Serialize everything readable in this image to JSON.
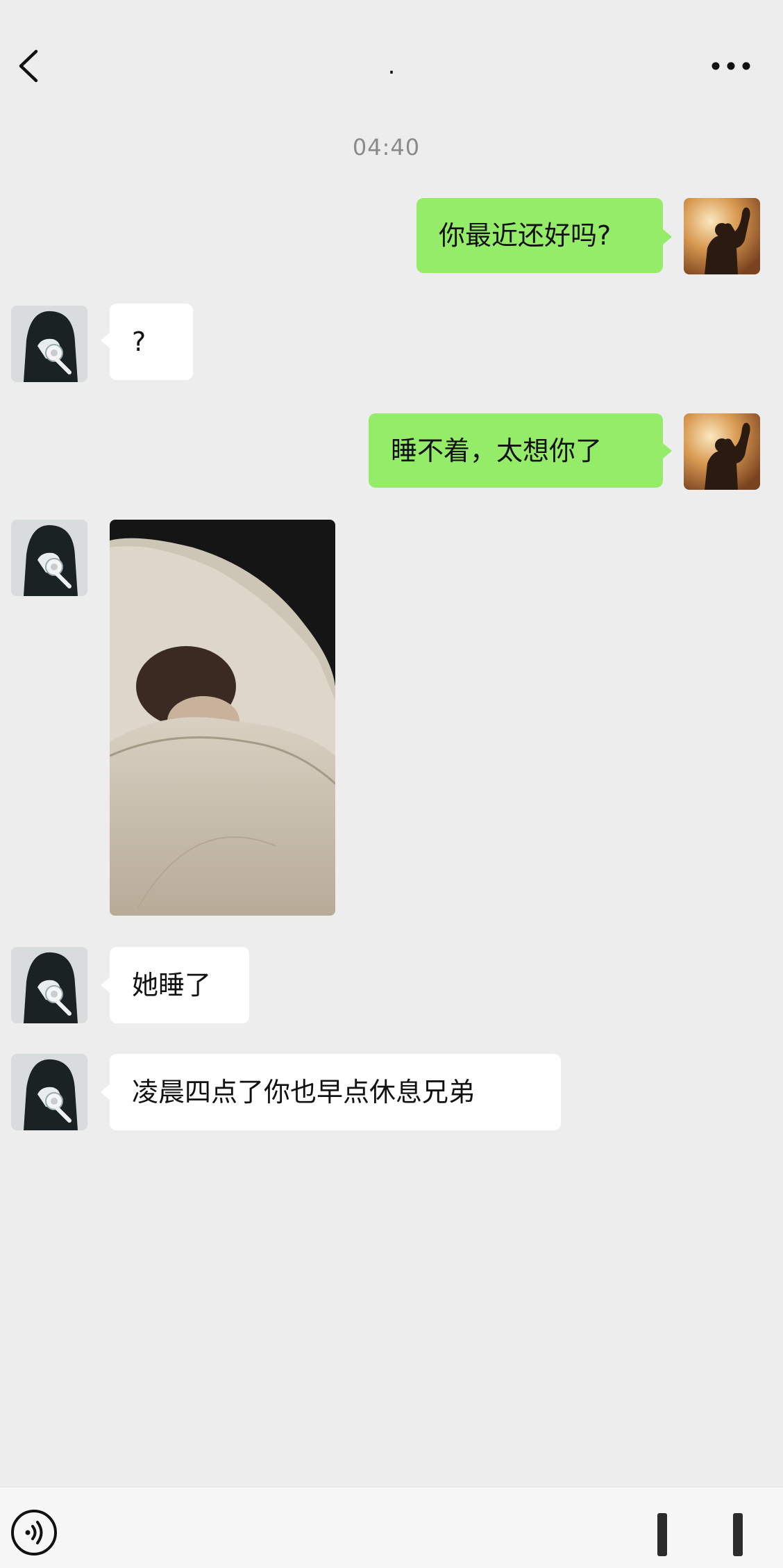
{
  "header": {
    "title": ".",
    "back_icon": "chevron-left-icon",
    "more_icon": "more-dots-icon"
  },
  "timestamp": "04:40",
  "messages": [
    {
      "sender": "me",
      "text": "你最近还好吗?"
    },
    {
      "sender": "other",
      "text": "?"
    },
    {
      "sender": "me",
      "text": "睡不着，太想你了"
    },
    {
      "sender": "other",
      "type": "image",
      "description_icon": "photo-sleeping-person"
    },
    {
      "sender": "other",
      "text": "她睡了"
    },
    {
      "sender": "other",
      "text": "凌晨四点了你也早点休息兄弟"
    }
  ],
  "colors": {
    "background": "#ededed",
    "my_bubble": "#95ec69",
    "other_bubble": "#ffffff",
    "timestamp": "#8a8a8a"
  },
  "input_bar": {
    "voice_icon": "voice-input-icon"
  }
}
